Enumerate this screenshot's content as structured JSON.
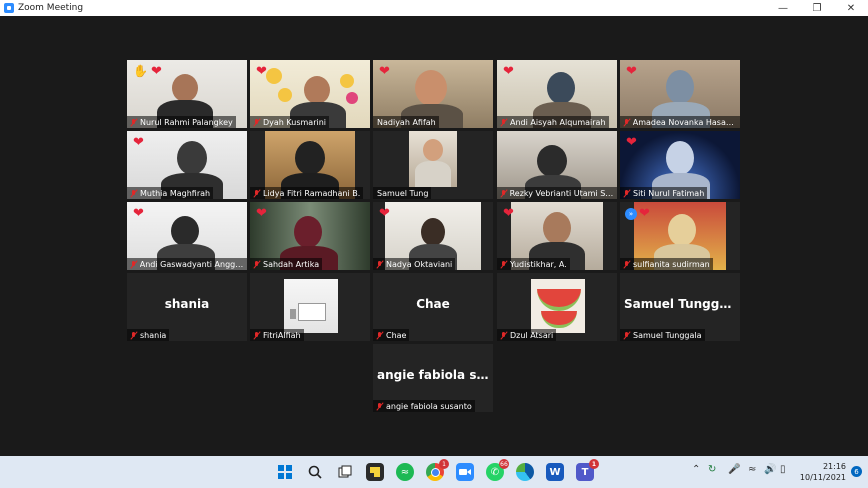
{
  "window": {
    "title": "Zoom Meeting"
  },
  "participants": [
    {
      "name": "Nurul Rahmi Palangkey"
    },
    {
      "name": "Dyah Kusmarini"
    },
    {
      "name": "Nadiyah Afifah"
    },
    {
      "name": "Andi Aisyah Alqumairah"
    },
    {
      "name": "Amadea Novanka Hasanah"
    },
    {
      "name": "Muthia Maghfirah"
    },
    {
      "name": "Lidya Fitri Ramadhani B."
    },
    {
      "name": "Samuel Tung"
    },
    {
      "name": "Rezky Vebrianti Utami Sul..."
    },
    {
      "name": "Siti Nurul Fatimah"
    },
    {
      "name": "Andi Gaswadyanti Angge..."
    },
    {
      "name": "Sahdah Artika"
    },
    {
      "name": "Nadya Oktaviani"
    },
    {
      "name": "Yudistikhar, A."
    },
    {
      "name": "sulfianita sudirman"
    },
    {
      "name": "shania",
      "display": "shania"
    },
    {
      "name": "FitriAlfiah"
    },
    {
      "name": "Chae",
      "display": "Chae"
    },
    {
      "name": "Dzul Atsari"
    },
    {
      "name": "Samuel Tunggala",
      "display": "Samuel Tunggala"
    },
    {
      "name": "angie fabiola susanto",
      "display": "angie fabiola su..."
    }
  ],
  "taskbar": {
    "time": "21:16",
    "date": "10/11/2021",
    "chrome_badge": "1",
    "whatsapp_badge": "66",
    "teams_badge": "1",
    "notification_count": "6"
  },
  "colors": {
    "active_speaker": "#c4d94a",
    "background": "#1a1a1a",
    "reaction_heart": "#e5243b"
  }
}
